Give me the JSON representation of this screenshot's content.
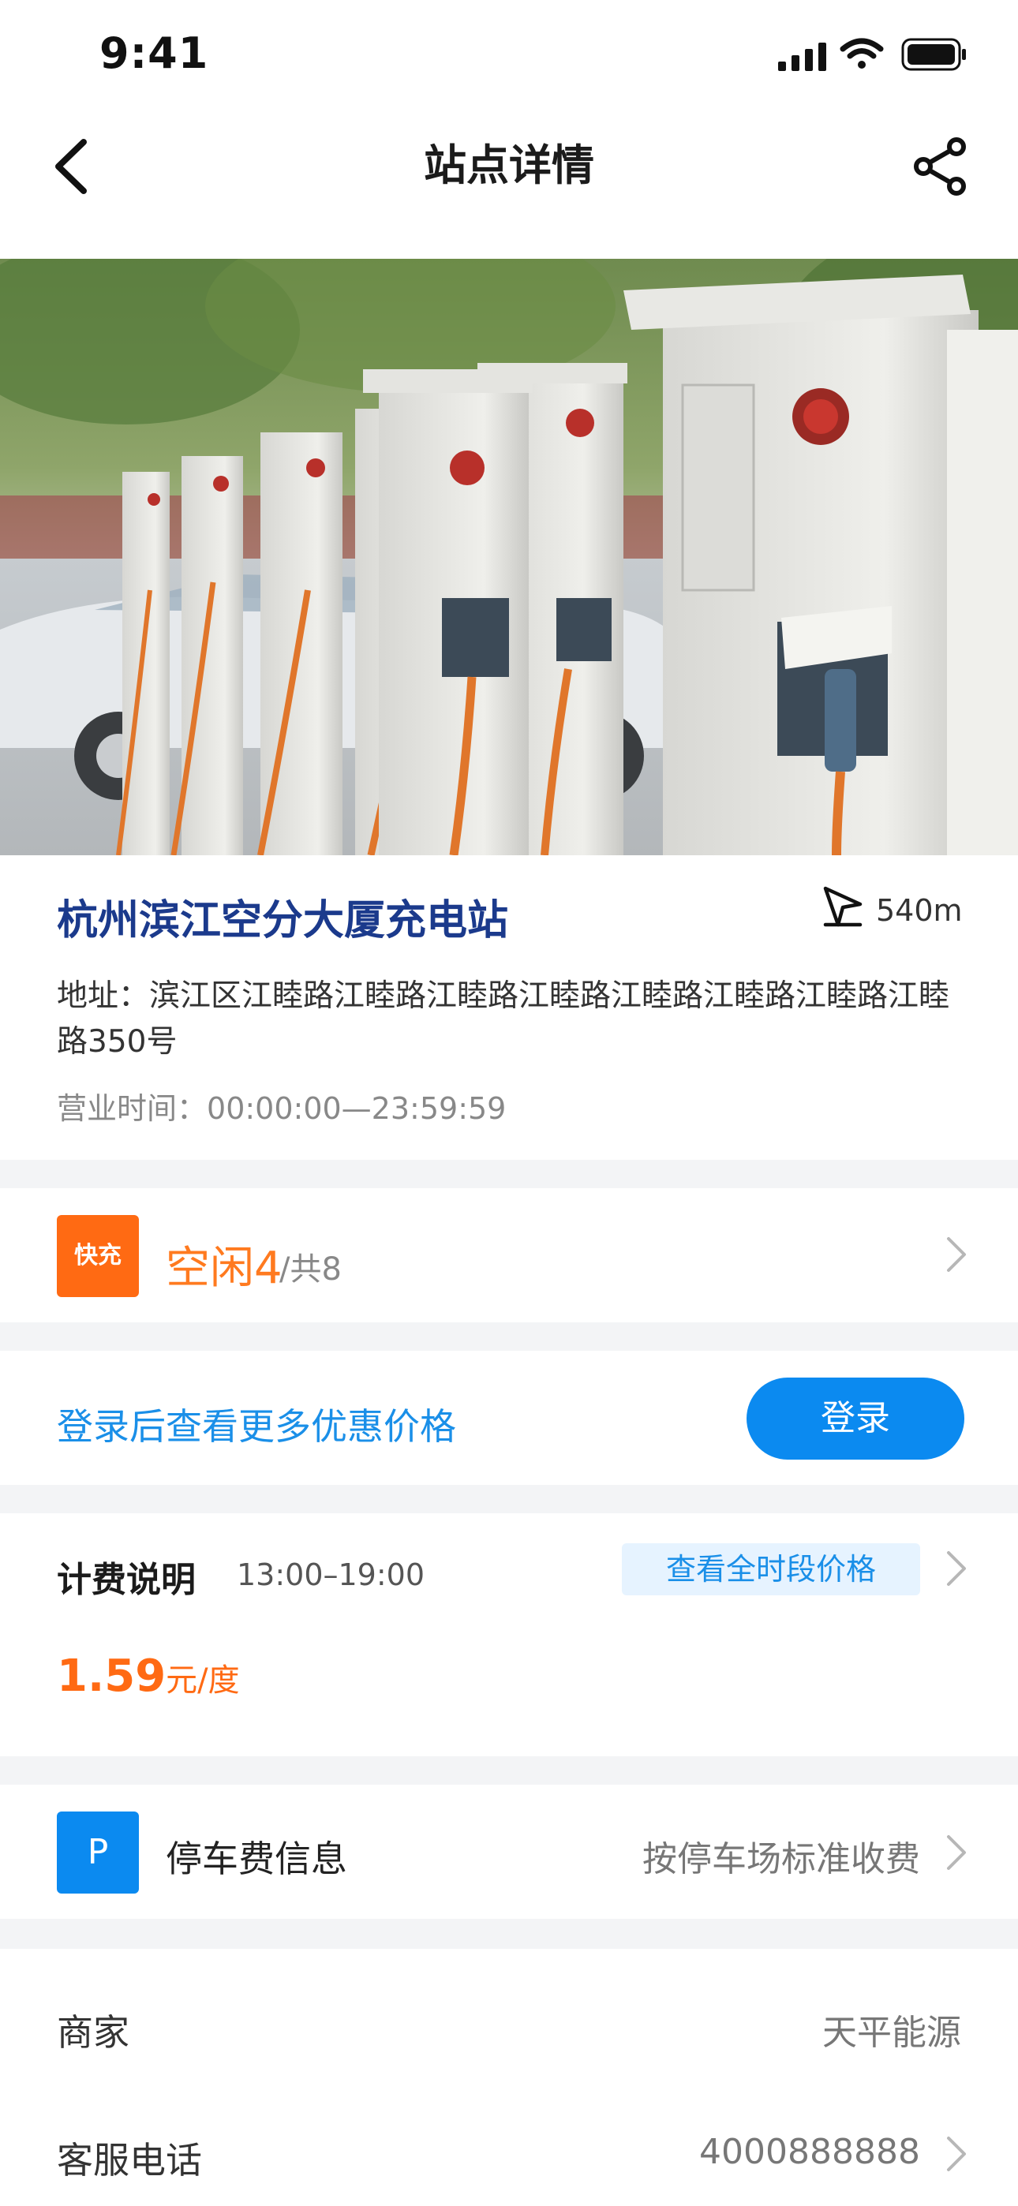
{
  "status_bar": {
    "time": "9:41"
  },
  "nav": {
    "title": "站点详情",
    "back_icon": "chevron-left-icon",
    "share_icon": "share-icon"
  },
  "hero_image": {
    "alt": "充电桩照片"
  },
  "station": {
    "name": "杭州滨江空分大厦充电站",
    "distance": "540m",
    "address_label": "地址：",
    "address": "滨江区江睦路江睦路江睦路江睦路江睦路江睦路江睦路江睦路350号",
    "hours_label": "营业时间：",
    "hours": "00:00:00—23:59:59"
  },
  "fast_charge": {
    "badge": "快充",
    "free": "空闲4",
    "total": "/共8"
  },
  "login_banner": {
    "tip": "登录后查看更多优惠价格",
    "button": "登录"
  },
  "pricing": {
    "title": "计费说明",
    "time_range": "13:00–19:00",
    "view_all": "查看全时段价格",
    "price": "1.59",
    "unit": "元/度"
  },
  "parking": {
    "badge": "P",
    "title": "停车费信息",
    "value": "按停车场标准收费"
  },
  "merchant": {
    "label": "商家",
    "value": "天平能源"
  },
  "service_phone": {
    "label": "客服电话",
    "value": "4000888888"
  },
  "colors": {
    "accent_blue": "#0b8af0",
    "accent_orange": "#ff6a13",
    "title_navy": "#1b3a8c"
  }
}
